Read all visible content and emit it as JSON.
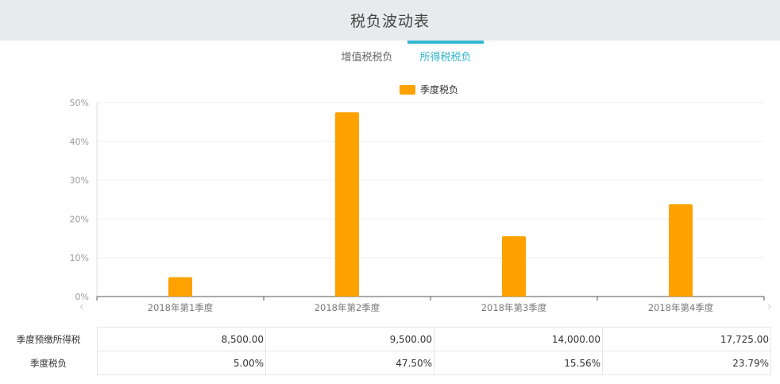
{
  "header": {
    "title": "税负波动表"
  },
  "tabs": [
    {
      "label": "增值税税负",
      "active": false
    },
    {
      "label": "所得税税负",
      "active": true
    }
  ],
  "colors": {
    "bar": "#ffa200",
    "accent": "#2fb5cf",
    "header_bg": "#e8eaed"
  },
  "chart_data": {
    "type": "bar",
    "categories": [
      "2018年第1季度",
      "2018年第2季度",
      "2018年第3季度",
      "2018年第4季度"
    ],
    "series": [
      {
        "name": "季度税负",
        "values": [
          5.0,
          47.5,
          15.56,
          23.79
        ]
      }
    ],
    "yticks": [
      "0%",
      "10%",
      "20%",
      "30%",
      "40%",
      "50%"
    ],
    "ylim": [
      0,
      50
    ],
    "legend": "top-center",
    "grid": true
  },
  "table": {
    "rows": [
      {
        "label": "季度预缴所得税",
        "values": [
          "8,500.00",
          "9,500.00",
          "14,000.00",
          "17,725.00"
        ]
      },
      {
        "label": "季度税负",
        "values": [
          "5.00%",
          "47.50%",
          "15.56%",
          "23.79%"
        ]
      }
    ]
  },
  "nav": {
    "prev_icon": "chevron-left-icon",
    "next_icon": "chevron-right-icon"
  }
}
